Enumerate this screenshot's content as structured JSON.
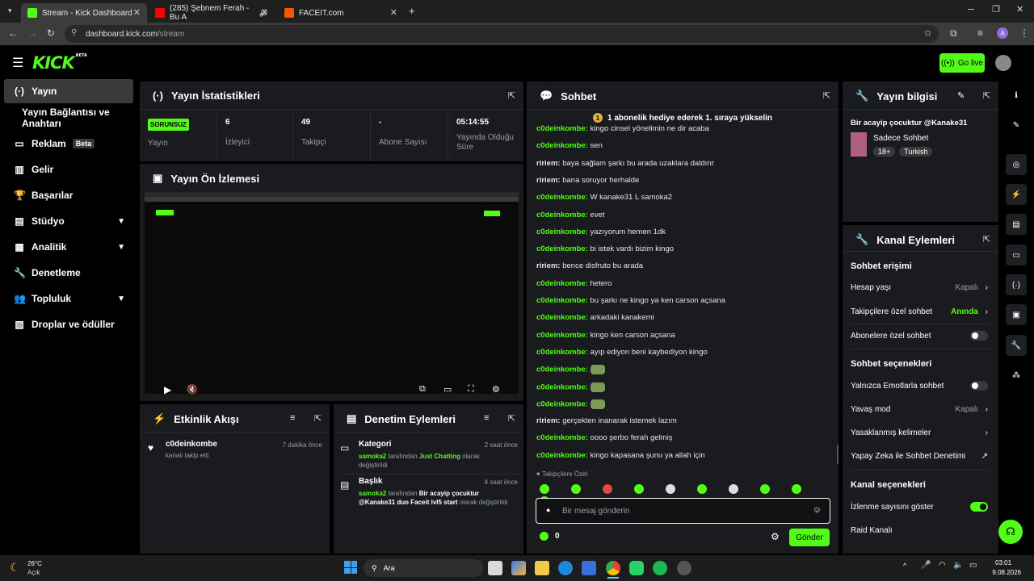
{
  "browser": {
    "tabs": [
      {
        "title": "Stream - Kick Dashboard"
      },
      {
        "title": "(285) Şebnem Ferah - Bu A"
      },
      {
        "title": "FACEIT.com"
      }
    ],
    "url_host": "dashboard.kick.com",
    "url_path": "/stream",
    "profile_initial": "A"
  },
  "header": {
    "logo": "KICK",
    "logo_sup": "BETA",
    "go_live": "Go live"
  },
  "sidebar": {
    "items": [
      {
        "label": "Yayın",
        "icon": "broadcast-icon"
      },
      {
        "label": "Yayın Bağlantısı ve Anahtarı",
        "icon": ""
      },
      {
        "label": "Reklam",
        "icon": "ad-icon",
        "badge": "Beta"
      },
      {
        "label": "Gelir",
        "icon": "chart-icon"
      },
      {
        "label": "Başarılar",
        "icon": "trophy-icon"
      },
      {
        "label": "Stüdyo",
        "icon": "studio-icon"
      },
      {
        "label": "Analitik",
        "icon": "analytics-icon"
      },
      {
        "label": "Denetleme",
        "icon": "wrench-icon"
      },
      {
        "label": "Topluluk",
        "icon": "community-icon"
      },
      {
        "label": "Droplar ve ödüller",
        "icon": "drops-icon"
      }
    ]
  },
  "stats": {
    "title": "Yayın İstatistikleri",
    "status": "SORUNSUZ",
    "cells": [
      {
        "value": "",
        "label": "Yayın"
      },
      {
        "value": "6",
        "label": "İzleyici"
      },
      {
        "value": "49",
        "label": "Takipçi"
      },
      {
        "value": "-",
        "label": "Abone Sayısı"
      },
      {
        "value": "05:14:55",
        "label": "Yayında Olduğu Süre"
      }
    ]
  },
  "preview": {
    "title": "Yayın Ön İzlemesi"
  },
  "activity": {
    "title": "Etkinlik Akışı",
    "items": [
      {
        "user": "c0deinkombe",
        "text": "kanalı takip etti",
        "time": "7 dakika önce"
      }
    ]
  },
  "moderation": {
    "title": "Denetim Eylemleri",
    "items": [
      {
        "title": "Kategori",
        "time": "2 saat önce",
        "user": "samoka2",
        "mid": " tarafından ",
        "value": "Just Chatting",
        "tail": " olarak değiştirildi"
      },
      {
        "title": "Başlık",
        "time": "4 saat önce",
        "user": "samoka2",
        "mid": " tarafından ",
        "value": "Bir acayip çocuktur @Kanake31 duo Faceit lvl5 start",
        "tail": " olarak değiştirildi"
      }
    ]
  },
  "chat": {
    "title": "Sohbet",
    "pinned": "1 abonelik hediye ederek 1. sıraya yükselin",
    "messages": [
      {
        "user": "c0deinkombe",
        "color": "green",
        "text": "kingo cinsel yönelimin ne dir acaba"
      },
      {
        "user": "c0deinkombe",
        "color": "green",
        "text": "sen"
      },
      {
        "user": "ririem",
        "color": "white",
        "text": "baya sağlam şarkı bu arada uzaklara daldırır"
      },
      {
        "user": "ririem",
        "color": "white",
        "text": "bana soruyor herhalde"
      },
      {
        "user": "c0deinkombe",
        "color": "green",
        "text": "W kanake31 L samoka2"
      },
      {
        "user": "c0deinkombe",
        "color": "green",
        "text": "evet"
      },
      {
        "user": "c0deinkombe",
        "color": "green",
        "text": "yazıyorum hemen 1dk"
      },
      {
        "user": "c0deinkombe",
        "color": "green",
        "text": "bi istek vardı bizim kingo"
      },
      {
        "user": "ririem",
        "color": "white",
        "text": "bence disfruto bu arada"
      },
      {
        "user": "c0deinkombe",
        "color": "green",
        "text": "hetero"
      },
      {
        "user": "c0deinkombe",
        "color": "green",
        "text": "bu şarkı ne kingo ya ken carson açsana"
      },
      {
        "user": "c0deinkombe",
        "color": "green",
        "text": "arkadaki kanakemi"
      },
      {
        "user": "c0deinkombe",
        "color": "green",
        "text": "kingo ken carson açsana"
      },
      {
        "user": "c0deinkombe",
        "color": "green",
        "text": "ayıp ediyon beni kaybediyon kingo"
      },
      {
        "user": "c0deinkombe",
        "color": "green",
        "text": "",
        "emote": true
      },
      {
        "user": "c0deinkombe",
        "color": "green",
        "text": "",
        "emote": true
      },
      {
        "user": "c0deinkombe",
        "color": "green",
        "text": "",
        "emote": true
      },
      {
        "user": "ririem",
        "color": "white",
        "text": "gerçekten inanarak istemek lazım"
      },
      {
        "user": "c0deinkombe",
        "color": "green",
        "text": "oooo şerbo ferah gelmiş"
      },
      {
        "user": "c0deinkombe",
        "color": "green",
        "text": "kingo kapasana şunu ya allah için"
      }
    ],
    "followers_label": "Takipçilere Özel",
    "placeholder": "Bir mesaj gönderin",
    "points": "0",
    "send": "Gönder"
  },
  "stream_info": {
    "title": "Yayın bilgisi",
    "stream_title": "Bir acayip çocuktur @Kanake31",
    "category": "Sadece Sohbet",
    "tags": [
      "18+",
      "Turkish"
    ]
  },
  "channel_actions": {
    "title": "Kanal Eylemleri",
    "chat_access": "Sohbet erişimi",
    "rows_access": [
      {
        "label": "Hesap yaşı",
        "value": "Kapalı",
        "type": "chevron"
      },
      {
        "label": "Takipçilere özel sohbet",
        "value": "Anında",
        "type": "chevron-green"
      },
      {
        "label": "Abonelere özel sohbet",
        "value": "",
        "type": "toggle-off"
      }
    ],
    "chat_options": "Sohbet seçenekleri",
    "rows_options": [
      {
        "label": "Yalnızca Emotlarla sohbet",
        "value": "",
        "type": "toggle-off"
      },
      {
        "label": "Yavaş mod",
        "value": "Kapalı",
        "type": "chevron"
      },
      {
        "label": "Yasaklanmış kelimeler",
        "value": "",
        "type": "chevron"
      },
      {
        "label": "Yapay Zeka ile Sohbet Denetimi",
        "value": "",
        "type": "external"
      }
    ],
    "channel_options": "Kanal seçenekleri",
    "rows_channel": [
      {
        "label": "İzlenme sayısını göster",
        "value": "",
        "type": "toggle-on"
      },
      {
        "label": "Raid Kanalı",
        "value": "",
        "type": "none"
      }
    ]
  },
  "taskbar": {
    "weather_temp": "26°C",
    "weather_desc": "Açık",
    "search": "Ara",
    "time": "03:01",
    "date": "9.08.2026"
  },
  "colors": {
    "accent": "#53fc18",
    "panel": "#191b1f",
    "bg": "#000000"
  }
}
